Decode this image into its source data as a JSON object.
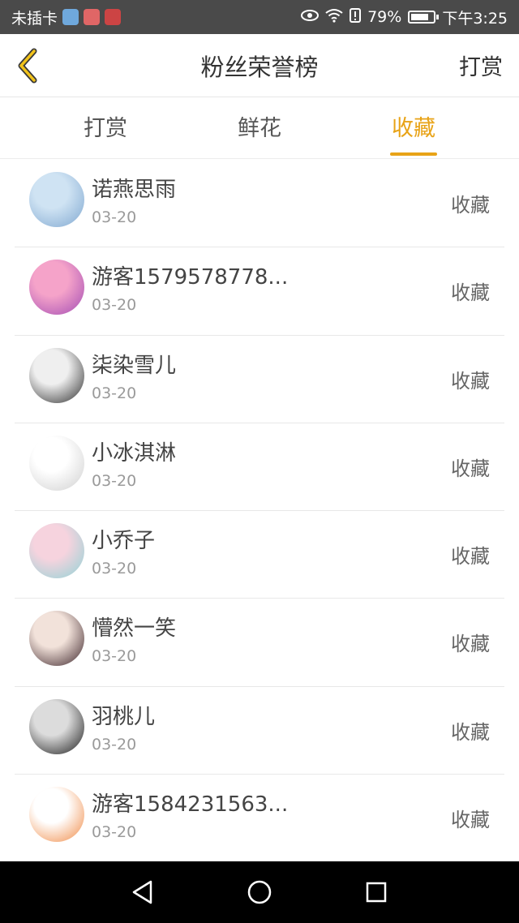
{
  "status_bar": {
    "carrier": "未插卡",
    "battery": "79%",
    "battery_level": 0.79,
    "time": "下午3:25"
  },
  "header": {
    "title": "粉丝荣誉榜",
    "action": "打赏",
    "accent_color": "#e8a317"
  },
  "tabs": [
    {
      "label": "打赏",
      "active": false
    },
    {
      "label": "鲜花",
      "active": false
    },
    {
      "label": "收藏",
      "active": true
    }
  ],
  "fans": [
    {
      "name": "诺燕思雨",
      "date": "03-20",
      "action": "收藏",
      "avatar_colors": [
        "#cfe3f3",
        "#7fa7d0"
      ]
    },
    {
      "name": "游客1579578778...",
      "date": "03-20",
      "action": "收藏",
      "avatar_colors": [
        "#f5a3c9",
        "#a24bb4"
      ]
    },
    {
      "name": "柒染雪儿",
      "date": "03-20",
      "action": "收藏",
      "avatar_colors": [
        "#efefef",
        "#2b2b2b"
      ]
    },
    {
      "name": "小冰淇淋",
      "date": "03-20",
      "action": "收藏",
      "avatar_colors": [
        "#ffffff",
        "#cfcfcf"
      ]
    },
    {
      "name": "小乔子",
      "date": "03-20",
      "action": "收藏",
      "avatar_colors": [
        "#f6d3de",
        "#8fd3d6"
      ]
    },
    {
      "name": "懵然一笑",
      "date": "03-20",
      "action": "收藏",
      "avatar_colors": [
        "#f2e2da",
        "#3a2228"
      ]
    },
    {
      "name": "羽桃儿",
      "date": "03-20",
      "action": "收藏",
      "avatar_colors": [
        "#dcdcdc",
        "#1a1a1a"
      ]
    },
    {
      "name": "游客1584231563...",
      "date": "03-20",
      "action": "收藏",
      "avatar_colors": [
        "#ffffff",
        "#f08a45"
      ]
    }
  ],
  "system_nav": {
    "buttons": [
      "back-icon",
      "home-icon",
      "recent-apps-icon"
    ]
  }
}
